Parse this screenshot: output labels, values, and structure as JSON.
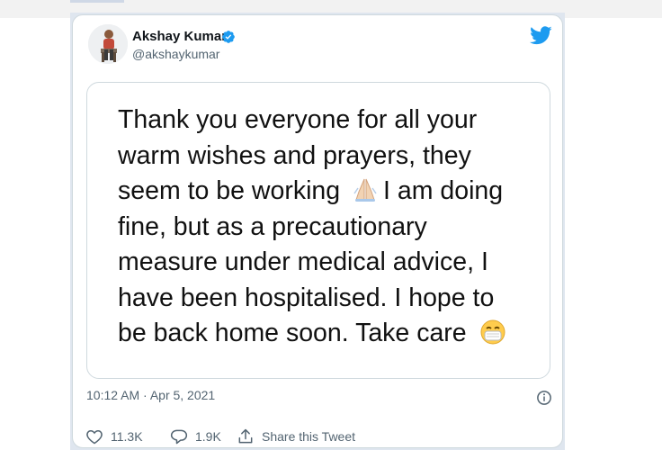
{
  "tweet": {
    "author": {
      "name": "Akshay Kumar",
      "handle": "@akshaykumar",
      "verified": true,
      "avatar": "person-avatar"
    },
    "media_text_lines": [
      "Thank you everyone for all your",
      "warm wishes and prayers, they",
      "seem to be working",
      "I am doing",
      "fine, but as a precautionary",
      "measure under medical advice, I",
      "have been hospitalised. I hope to",
      "be back home soon. Take care"
    ],
    "media_emojis": [
      "folded-hands-emoji",
      "face-with-medical-mask-emoji"
    ],
    "timestamp": "10:12 AM · Apr 5, 2021",
    "likes": "11.3K",
    "replies": "1.9K",
    "share_label": "Share this Tweet"
  },
  "icons": {
    "brand": "twitter-bird-icon",
    "verified": "verified-badge-icon",
    "info": "info-icon",
    "like": "heart-icon",
    "reply": "speech-bubble-icon",
    "share": "share-upload-icon"
  },
  "colors": {
    "twitter_blue": "#1d9bf0",
    "text_primary": "#0f1419",
    "text_secondary": "#536471",
    "border": "#cfd9de"
  }
}
